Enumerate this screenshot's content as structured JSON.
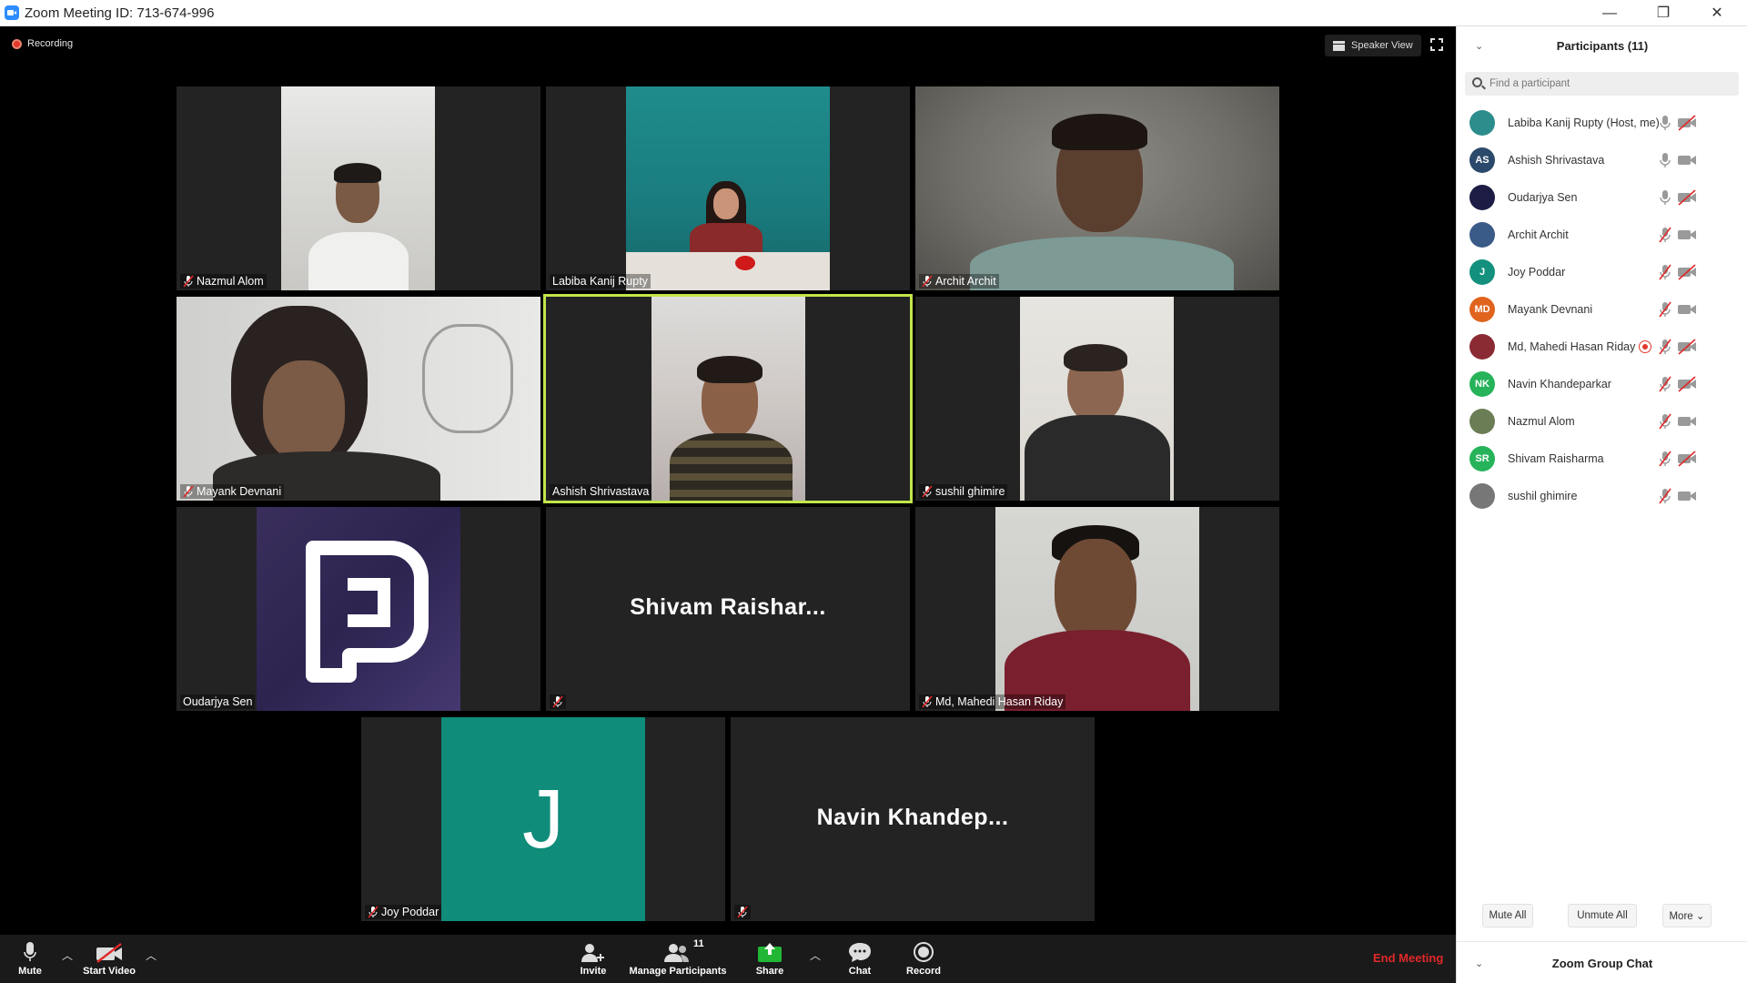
{
  "window": {
    "title": "Zoom Meeting ID: 713-674-996",
    "minimize": "—",
    "restore": "❐",
    "close": "✕"
  },
  "meeting": {
    "recording_label": "Recording",
    "view_label": "Speaker View"
  },
  "tiles": [
    {
      "name": "Nazmul Alom",
      "muted": true
    },
    {
      "name": "Labiba Kanij Rupty",
      "muted": false
    },
    {
      "name": "Archit Archit",
      "muted": true
    },
    {
      "name": "Mayank Devnani",
      "muted": true
    },
    {
      "name": "Ashish Shrivastava",
      "muted": false,
      "active_speaker": true
    },
    {
      "name": "sushil ghimire",
      "muted": true
    },
    {
      "name": "Oudarjya Sen",
      "muted": false
    },
    {
      "name": "",
      "display_name": "Shivam  Raishar...",
      "muted": true
    },
    {
      "name": "Md, Mahedi Hasan Riday",
      "muted": true
    },
    {
      "name": "Joy Poddar",
      "muted": true,
      "avatar_letter": "J"
    },
    {
      "name": "",
      "display_name": "Navin  Khandep...",
      "muted": true
    }
  ],
  "toolbar": {
    "mute_label": "Mute",
    "start_video_label": "Start Video",
    "invite_label": "Invite",
    "manage_participants_label": "Manage Participants",
    "participant_count": "11",
    "share_label": "Share",
    "chat_label": "Chat",
    "record_label": "Record",
    "end_meeting_label": "End Meeting"
  },
  "panel": {
    "title": "Participants (11)",
    "search_placeholder": "Find a participant",
    "participants": [
      {
        "name": "Labiba Kanij Rupty (Host, me)",
        "initials": "",
        "avatar_color": "#2d8c8c",
        "mic": "on",
        "cam": "off"
      },
      {
        "name": "Ashish Shrivastava",
        "initials": "AS",
        "avatar_color": "#2b4a6b",
        "mic": "on",
        "cam": "on"
      },
      {
        "name": "Oudarjya Sen",
        "initials": "",
        "avatar_color": "#1c1c44",
        "mic": "on",
        "cam": "off"
      },
      {
        "name": "Archit Archit",
        "initials": "",
        "avatar_color": "#3a5a88",
        "mic": "off",
        "cam": "on"
      },
      {
        "name": "Joy Poddar",
        "initials": "J",
        "avatar_color": "#13907e",
        "mic": "off",
        "cam": "off"
      },
      {
        "name": "Mayank Devnani",
        "initials": "MD",
        "avatar_color": "#e0641e",
        "mic": "off",
        "cam": "on"
      },
      {
        "name": "Md, Mahedi Hasan Riday",
        "initials": "",
        "avatar_color": "#8a2a33",
        "mic": "off",
        "cam": "off",
        "recording": true
      },
      {
        "name": "Navin Khandeparkar",
        "initials": "NK",
        "avatar_color": "#26b35a",
        "mic": "off",
        "cam": "off"
      },
      {
        "name": "Nazmul Alom",
        "initials": "",
        "avatar_color": "#6b7d55",
        "mic": "off",
        "cam": "on"
      },
      {
        "name": "Shivam Raisharma",
        "initials": "SR",
        "avatar_color": "#26b35a",
        "mic": "off",
        "cam": "off"
      },
      {
        "name": "sushil ghimire",
        "initials": "",
        "avatar_color": "#777777",
        "mic": "off",
        "cam": "on"
      }
    ],
    "mute_all_label": "Mute All",
    "unmute_all_label": "Unmute All",
    "more_label": "More ⌄",
    "chat_title": "Zoom Group Chat"
  }
}
